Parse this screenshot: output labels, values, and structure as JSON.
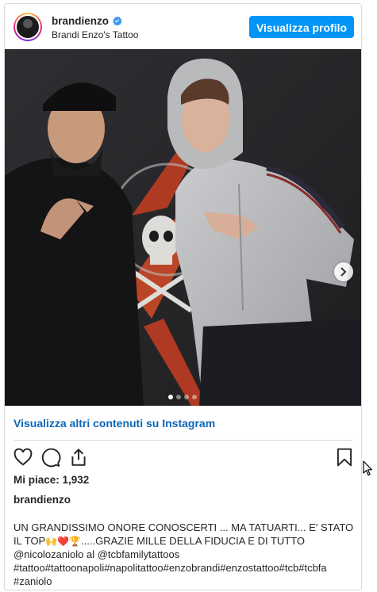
{
  "header": {
    "username": "brandienzo",
    "subtitle": "Brandi Enzo's Tattoo",
    "profile_button": "Visualizza profilo"
  },
  "media": {
    "carousel_dots": 4,
    "active_dot": 1
  },
  "links": {
    "more_on_instagram": "Visualizza altri contenuti su Instagram"
  },
  "post": {
    "likes": "Mi piace: 1,932",
    "caption_user": "brandienzo",
    "caption_lines": [
      "UN GRANDISSIMO ONORE CONOSCERTI ... MA TATUARTI... E' STATO",
      "IL TOP",
      ".....GRAZIE MILLE DELLA FIDUCIA E DI TUTTO",
      "@nicolozaniolo al @tcbfamilytattoos",
      "#tattoo#tattoonapoli#napolitattoo#enzobrandi#enzostattoo#tcb#tcbfa",
      "#zaniolo"
    ],
    "caption_emojis": "🙌❤️🏆"
  },
  "icons": {
    "verified": "verified-badge-icon",
    "like": "heart-icon",
    "comment": "comment-icon",
    "share": "share-icon",
    "save": "bookmark-icon",
    "next": "chevron-right-icon",
    "cursor": "mouse-pointer-icon"
  },
  "colors": {
    "accent": "#0095f6",
    "link": "#00376b",
    "verified": "#3897f0"
  }
}
